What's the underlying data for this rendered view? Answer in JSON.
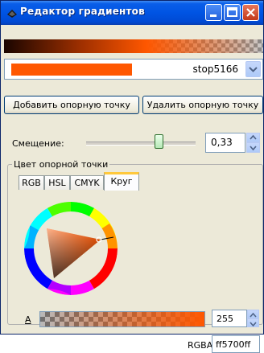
{
  "window": {
    "title": "Редактор градиентов"
  },
  "stop_selector": {
    "selected": "stop5166",
    "swatch_color": "#ff5700"
  },
  "buttons": {
    "add_stop": "Добавить опорную точку",
    "remove_stop": "Удалить опорную точку"
  },
  "offset": {
    "label": "Смещение:",
    "value": "0,33",
    "slider_fraction": 0.33
  },
  "stop_color_group": {
    "title": "Цвет опорной точки",
    "tabs": [
      "RGB",
      "HSL",
      "CMYK",
      "Круг"
    ],
    "active_tab": "Круг"
  },
  "alpha": {
    "label": "A",
    "value": "255"
  },
  "rgba": {
    "label": "RGBA:",
    "value": "ff5700ff"
  },
  "colors": {
    "accent": "#ff5700",
    "titlebar": "#0054e3",
    "window_bg": "#ece9d8"
  }
}
